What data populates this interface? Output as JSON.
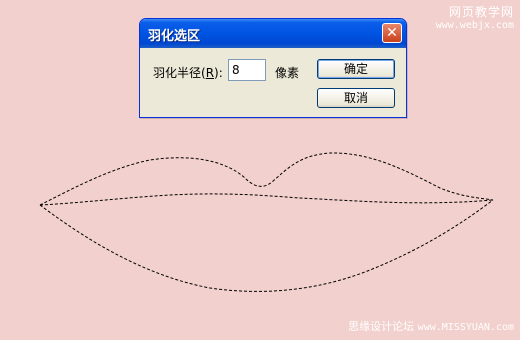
{
  "watermarks": {
    "top_line1": "网页教学网",
    "top_line2": "www.webjx.com",
    "bottom_text": "思缘设计论坛",
    "bottom_site": "www.MISSYUAN.com"
  },
  "dialog": {
    "title": "羽化选区",
    "close_glyph": "✕",
    "radius_label_prefix": "羽化半径(",
    "radius_label_key": "R",
    "radius_label_suffix": "):",
    "radius_value": "8",
    "unit": "像素",
    "ok_label": "确定",
    "cancel_label": "取消"
  },
  "colors": {
    "canvas": "#f2d0cd",
    "titlebar": "#0054e3",
    "dialog_bg": "#ece9d8"
  }
}
